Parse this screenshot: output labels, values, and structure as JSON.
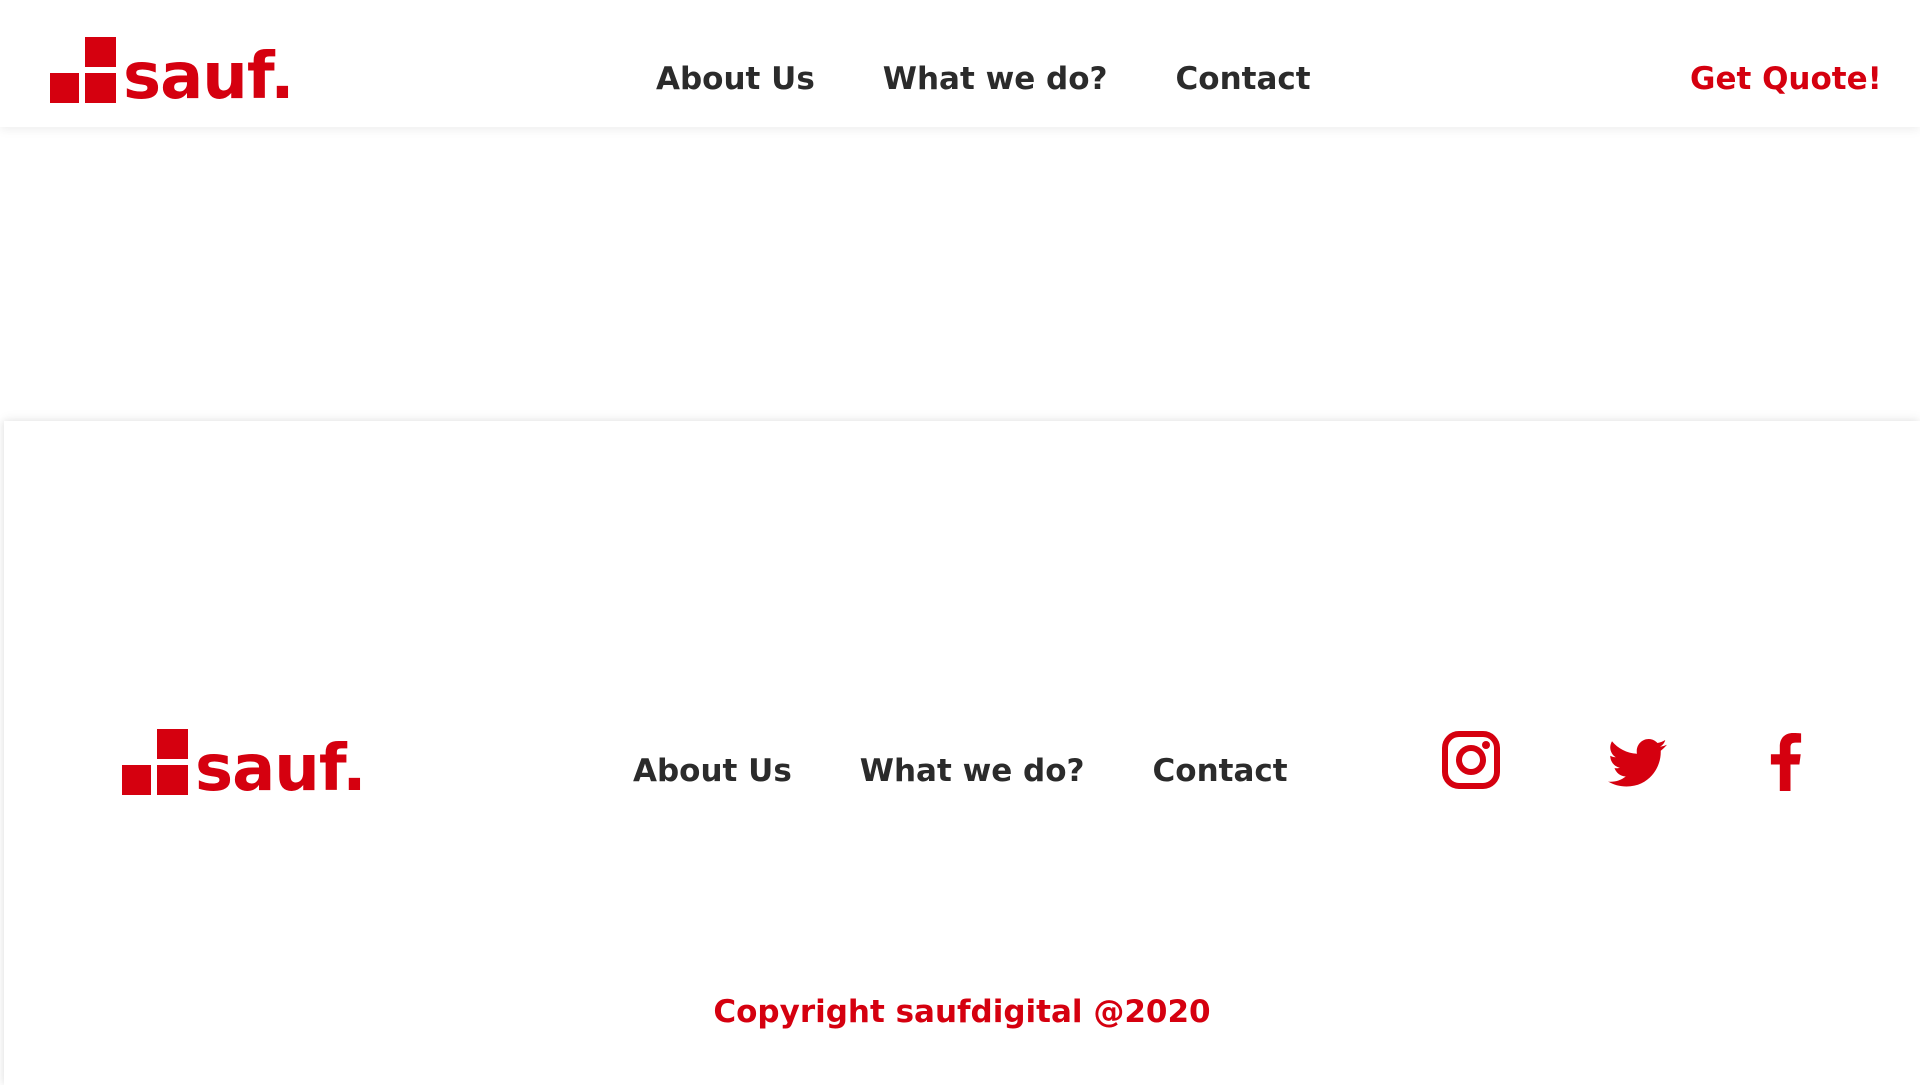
{
  "brand": {
    "name": "sauf.",
    "color": "#d5000f"
  },
  "header": {
    "nav": [
      {
        "label": "About Us"
      },
      {
        "label": "What we do?"
      },
      {
        "label": "Contact"
      }
    ],
    "cta_label": "Get Quote!"
  },
  "footer": {
    "nav": [
      {
        "label": "About Us"
      },
      {
        "label": "What we do?"
      },
      {
        "label": "Contact"
      }
    ],
    "social": [
      "instagram-icon",
      "twitter-icon",
      "facebook-icon"
    ],
    "copyright": "Copyright saufdigital @2020"
  }
}
